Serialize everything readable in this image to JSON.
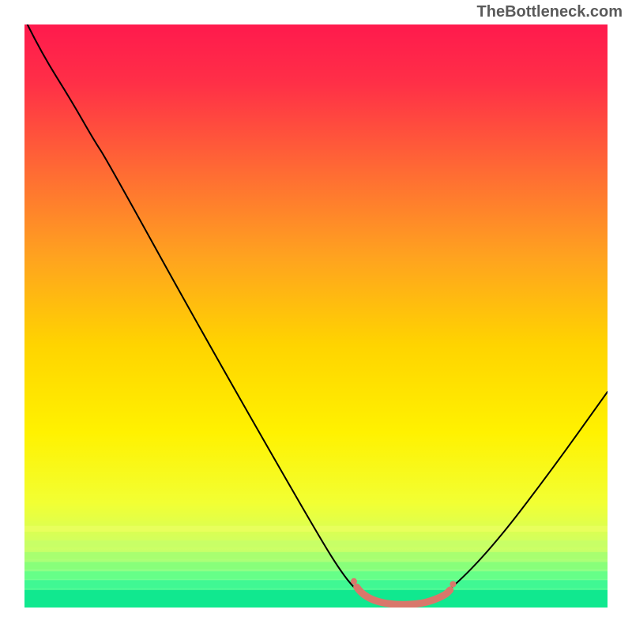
{
  "watermark": "TheBottleneck.com",
  "chart_data": {
    "type": "line",
    "title": "",
    "xlabel": "",
    "ylabel": "",
    "xlim": [
      0,
      100
    ],
    "ylim": [
      0,
      100
    ],
    "series": [
      {
        "name": "curve",
        "color": "#000000",
        "stroke_width": 2,
        "points": [
          {
            "x": 0.5,
            "y": 100
          },
          {
            "x": 3,
            "y": 95
          },
          {
            "x": 8,
            "y": 87
          },
          {
            "x": 12,
            "y": 80
          },
          {
            "x": 14,
            "y": 77
          },
          {
            "x": 30,
            "y": 48
          },
          {
            "x": 50,
            "y": 13
          },
          {
            "x": 55,
            "y": 5
          },
          {
            "x": 58,
            "y": 2
          },
          {
            "x": 62,
            "y": 0.5
          },
          {
            "x": 68,
            "y": 0.5
          },
          {
            "x": 72,
            "y": 2
          },
          {
            "x": 80,
            "y": 10
          },
          {
            "x": 90,
            "y": 23
          },
          {
            "x": 100,
            "y": 37
          }
        ]
      },
      {
        "name": "highlight",
        "color": "#d9776b",
        "stroke_width": 9,
        "points": [
          {
            "x": 57,
            "y": 3.5
          },
          {
            "x": 58,
            "y": 2
          },
          {
            "x": 62,
            "y": 0.5
          },
          {
            "x": 68,
            "y": 0.5
          },
          {
            "x": 72,
            "y": 2
          },
          {
            "x": 73,
            "y": 3
          }
        ]
      }
    ],
    "highlight_dots": [
      {
        "x": 56.5,
        "y": 4.5,
        "r": 4,
        "color": "#d9776b"
      },
      {
        "x": 73.5,
        "y": 4,
        "r": 4,
        "color": "#d9776b"
      }
    ],
    "background": {
      "type": "vertical-gradient",
      "stops": [
        {
          "offset": 0.0,
          "color": "#ff1a4d"
        },
        {
          "offset": 0.1,
          "color": "#ff2f47"
        },
        {
          "offset": 0.25,
          "color": "#ff6a34"
        },
        {
          "offset": 0.4,
          "color": "#ffa31f"
        },
        {
          "offset": 0.55,
          "color": "#ffd400"
        },
        {
          "offset": 0.7,
          "color": "#fff200"
        },
        {
          "offset": 0.82,
          "color": "#f2ff33"
        },
        {
          "offset": 0.9,
          "color": "#ccff66"
        },
        {
          "offset": 0.96,
          "color": "#66ff99"
        },
        {
          "offset": 1.0,
          "color": "#00e88a"
        }
      ],
      "green_bands": true
    }
  }
}
